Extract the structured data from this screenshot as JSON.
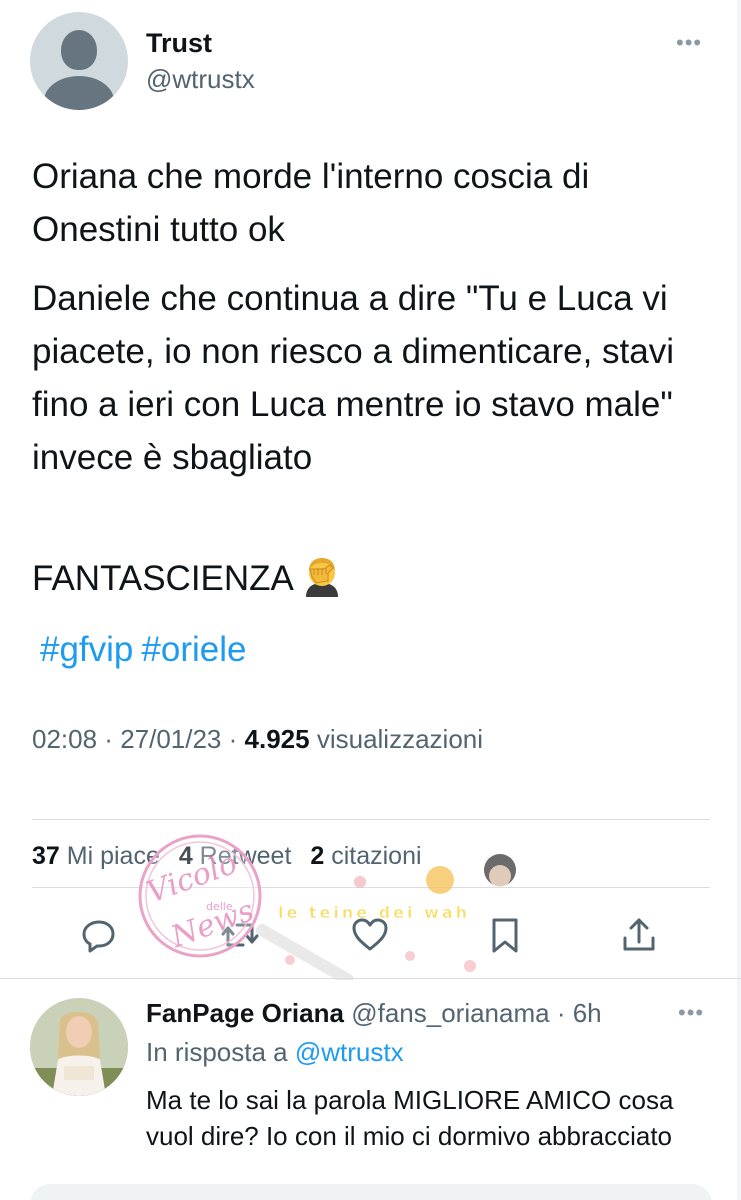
{
  "tweet": {
    "author": {
      "name": "Trust",
      "handle": "@wtrustx"
    },
    "more_icon": "•••",
    "paragraphs": [
      "Oriana che morde l'interno coscia di Onestini tutto ok",
      "Daniele che continua a dire \"Tu e Luca vi piacete, io non riesco a dimenticare, stavi fino a ieri con Luca mentre io stavo male\" invece è sbagliato",
      "FANTASCIENZA"
    ],
    "emoji": "facepalm-emoji",
    "hashtags": [
      "#gfvip",
      "#oriele"
    ],
    "time": "02:08",
    "date": "27/01/23",
    "views_count": "4.925",
    "views_label": "visualizzazioni",
    "likes_count": "37",
    "likes_label": "Mi piace",
    "retweets_count": "4",
    "retweets_label": "Retweet",
    "quotes_count": "2",
    "quotes_label": "citazioni",
    "actions": [
      "reply-icon",
      "retweet-icon",
      "like-icon",
      "bookmark-icon",
      "share-icon"
    ]
  },
  "reply": {
    "name": "FanPage Oriana",
    "handle": "@fans_orianama",
    "time": "6h",
    "in_reply_prefix": "In risposta a",
    "in_reply_handle": "@wtrustx",
    "text": "Ma te lo sai la parola MIGLIORE AMICO cosa vuol dire? Io con il mio ci dormivo abbracciato"
  },
  "watermark": {
    "stamp_text": "Vicolo delle News",
    "banner_text": "le teine dei wah"
  },
  "colors": {
    "accent": "#1d9bf0",
    "secondary_text": "#536471",
    "primary_text": "#0f1419"
  }
}
